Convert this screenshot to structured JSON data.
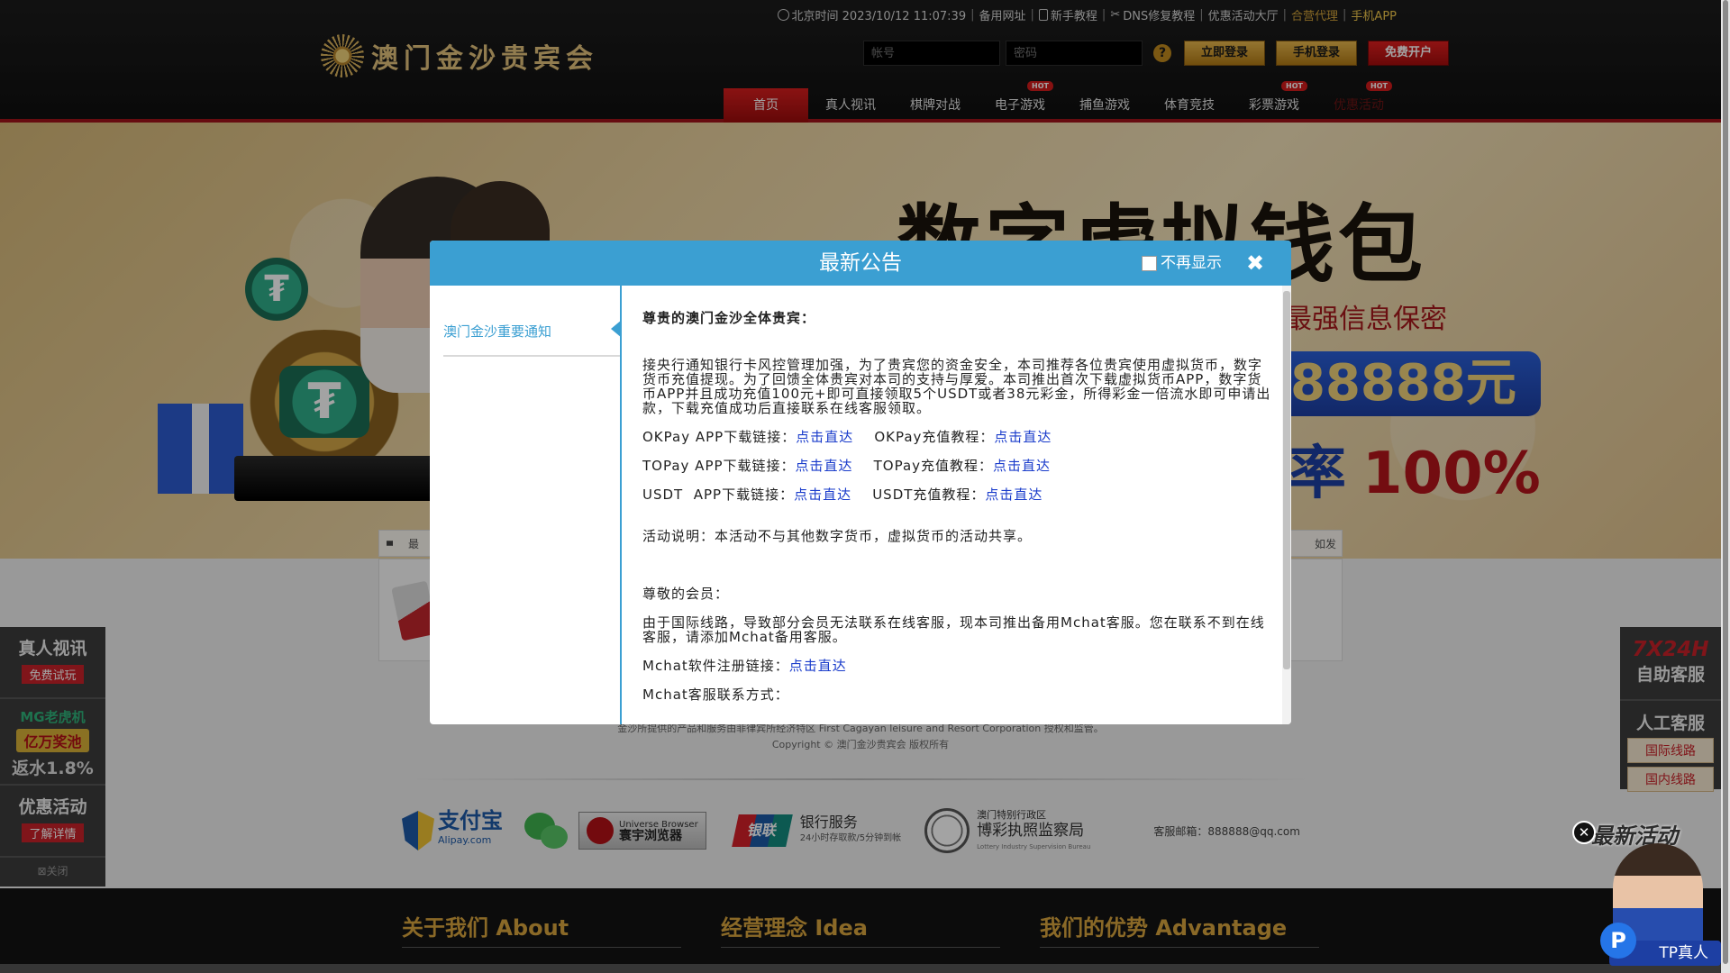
{
  "header": {
    "topbar": {
      "time": "北京时间 2023/10/12 11:07:39",
      "backup_url": "备用网址",
      "tutorial": "新手教程",
      "dns": "DNS修复教程",
      "promo_hall": "优惠活动大厅",
      "agent": "合营代理",
      "app": "手机APP"
    },
    "logo_text": "澳门金沙贵宾会",
    "login": {
      "account_placeholder": "帐号",
      "password_placeholder": "密码",
      "help": "?",
      "login_button": "立即登录",
      "mobile_login_button": "手机登录",
      "register_button": "免费开户"
    },
    "nav": [
      {
        "label": "首页"
      },
      {
        "label": "真人视讯"
      },
      {
        "label": "棋牌对战"
      },
      {
        "label": "电子游戏",
        "badge": "HOT"
      },
      {
        "label": "捕鱼游戏"
      },
      {
        "label": "体育竞技"
      },
      {
        "label": "彩票游戏",
        "badge": "HOT"
      },
      {
        "label": "优惠活动",
        "badge": "HOT"
      }
    ]
  },
  "banner": {
    "title": "数字虚拟钱包",
    "subtitle": "最强信息保密",
    "pill": "达88888元",
    "rate_prefix": "率",
    "rate": "100%"
  },
  "marquee": {
    "left": "最",
    "right": "如发"
  },
  "left_float": {
    "live_title": "真人视讯",
    "live_tag": "免费试玩",
    "mg_title": "MG老虎机",
    "mg_pool": "亿万奖池",
    "mg_rebate": "返水1.8%",
    "promo_title": "优惠活动",
    "promo_tag": "了解详情",
    "close": "关闭"
  },
  "right_float": {
    "hours": "7X24H",
    "self_service": "自助客服",
    "human_service": "人工客服",
    "intl_line": "国际线路",
    "domestic_line": "国内线路"
  },
  "footer": {
    "copyright_line1": "金沙所提供的产品和服务由菲律宾所经济特区 First Cagayan leisure and Resort Corporation 授权和监管。",
    "copyright_line2": "Copyright © 澳门金沙贵宾会 版权所有",
    "alipay": "支付宝",
    "alipay_en": "Alipay.com",
    "ub_en": "Universe Browser",
    "ub_cn": "寰宇浏览器",
    "unionpay": "银联",
    "bank_title": "银行服务",
    "bank_sub": "24小时存取款/5分钟到帐",
    "macau_small": "澳门特别行政区",
    "macau_big": "博彩执照监察局",
    "macau_en": "Lottery Industry Supervision Bureau",
    "email": "客服邮箱：888888@qq.com",
    "about": "关于我们 About",
    "idea": "经营理念 Idea",
    "advantage": "我们的优势 Advantage"
  },
  "modal": {
    "title": "最新公告",
    "no_show": "不再显示",
    "close": "✖",
    "side_item": "澳门金沙重要通知",
    "greeting": "尊贵的澳门金沙全体贵宾：",
    "para1": "接央行通知银行卡风控管理加强，为了贵宾您的资金安全，本司推荐各位贵宾使用虚拟货币，数字货币充值提现。为了回馈全体贵宾对本司的支持与厚爱。本司推出首次下载虚拟货币APP，数字货币APP并且成功充值100元+即可直接领取5个USDT或者38元彩金，所得彩金一倍流水即可申请出款，下载充值成功后直接联系在线客服领取。",
    "okpay_app": "OKPay APP下载链接：",
    "okpay_tut": "OKPay充值教程：",
    "topay_app": "TOPay APP下载链接：",
    "topay_tut": "TOPay充值教程：",
    "usdt_app": "USDT  APP下载链接：",
    "usdt_tut": "USDT充值教程：",
    "link": "点击直达",
    "activity": "活动说明：本活动不与其他数字货币，虚拟货币的活动共享。",
    "member": "尊敬的会员：",
    "para2": "由于国际线路，导致部分会员无法联系在线客服，现本司推出备用Mchat客服。您在联系不到在线客服，请添加Mchat备用客服。",
    "mchat_reg": "Mchat软件注册链接：",
    "mchat_contact": "Mchat客服联系方式："
  },
  "promo_popup": {
    "close": "✕",
    "title": "最新活动",
    "label": "TP真人",
    "icon_letter": "P"
  }
}
